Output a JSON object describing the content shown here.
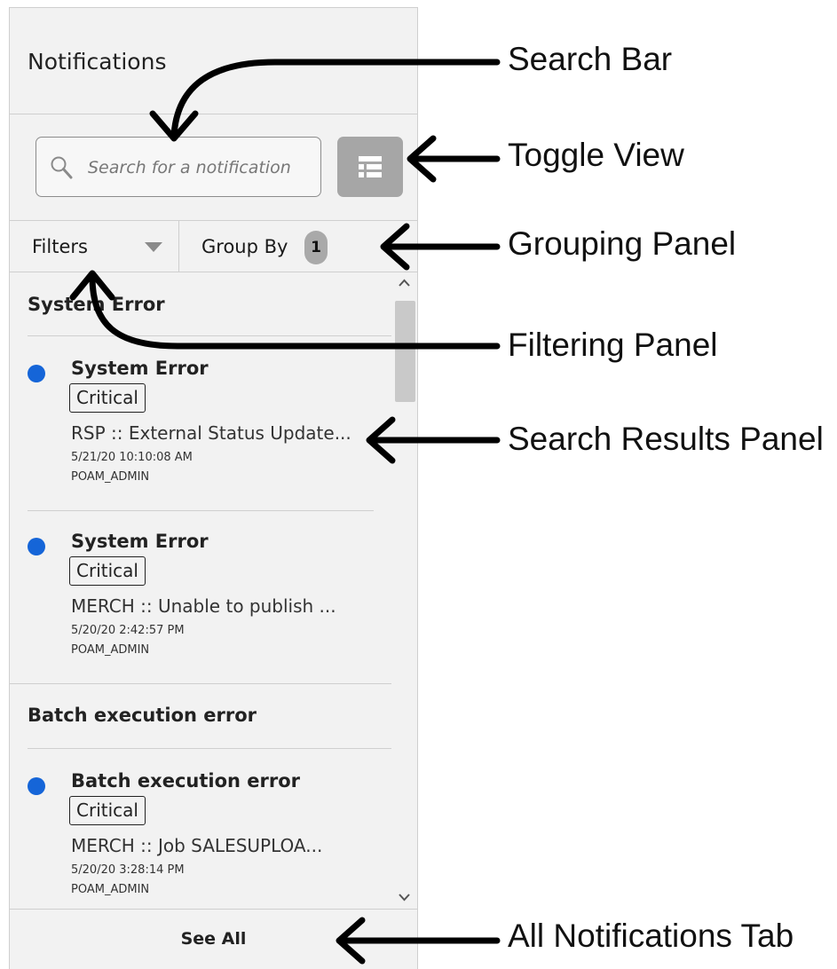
{
  "panel": {
    "title": "Notifications",
    "search": {
      "placeholder": "Search for a notification",
      "icon": "search-icon"
    },
    "toggle_view": {
      "icon": "list-view-icon",
      "color": "#a6a6a6"
    },
    "tabs": {
      "filters": {
        "label": "Filters"
      },
      "group_by": {
        "label": "Group By",
        "badge": "1"
      }
    },
    "groups": [
      {
        "heading": "System Error",
        "items": [
          {
            "title": "System Error",
            "severity": "Critical",
            "description": "RSP :: External Status Update...",
            "timestamp": "5/21/20 10:10:08 AM",
            "user": "POAM_ADMIN"
          },
          {
            "title": "System Error",
            "severity": "Critical",
            "description": "MERCH :: Unable to publish ...",
            "timestamp": "5/20/20 2:42:57 PM",
            "user": "POAM_ADMIN"
          }
        ]
      },
      {
        "heading": "Batch execution error",
        "items": [
          {
            "title": "Batch execution error",
            "severity": "Critical",
            "description": "MERCH :: Job SALESUPLOA...",
            "timestamp": "5/20/20 3:28:14 PM",
            "user": "POAM_ADMIN"
          }
        ]
      }
    ],
    "footer": {
      "see_all": "See All"
    },
    "colors": {
      "unread_dot": "#1565d8",
      "panel_bg": "#f2f2f2"
    }
  },
  "annotations": {
    "search_bar": "Search Bar",
    "toggle_view": "Toggle View",
    "grouping_panel": "Grouping Panel",
    "filtering_panel": "Filtering Panel",
    "search_results_panel": "Search Results Panel",
    "all_notifications_tab": "All Notifications Tab"
  }
}
